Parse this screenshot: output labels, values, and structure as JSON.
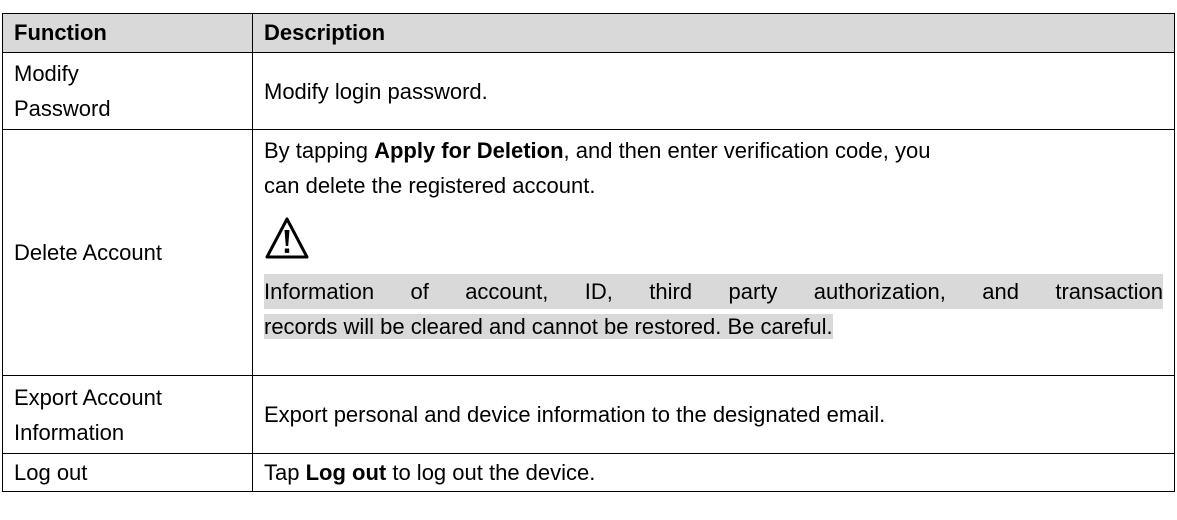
{
  "table": {
    "headers": {
      "function": "Function",
      "description": "Description"
    },
    "rows": {
      "modify_password": {
        "function_line1": "Modify",
        "function_line2": "Password",
        "description": "Modify login password."
      },
      "delete_account": {
        "function": "Delete Account",
        "description_prefix": "By tapping ",
        "description_bold": "Apply for Deletion",
        "description_line1_suffix": ", and then enter verification code, you",
        "description_line2": "can delete the registered account.",
        "warning_icon": "warning-triangle-icon",
        "note_line1": "Information of account, ID, third party authorization, and transaction",
        "note_line2": "records will be cleared and cannot be restored. Be careful."
      },
      "export_account": {
        "function_line1": "Export Account",
        "function_line2": "Information",
        "description": "Export personal and device information to the designated email."
      },
      "log_out": {
        "function": "Log out",
        "description_prefix": "Tap ",
        "description_bold": "Log out",
        "description_suffix": " to log out the device."
      }
    }
  }
}
